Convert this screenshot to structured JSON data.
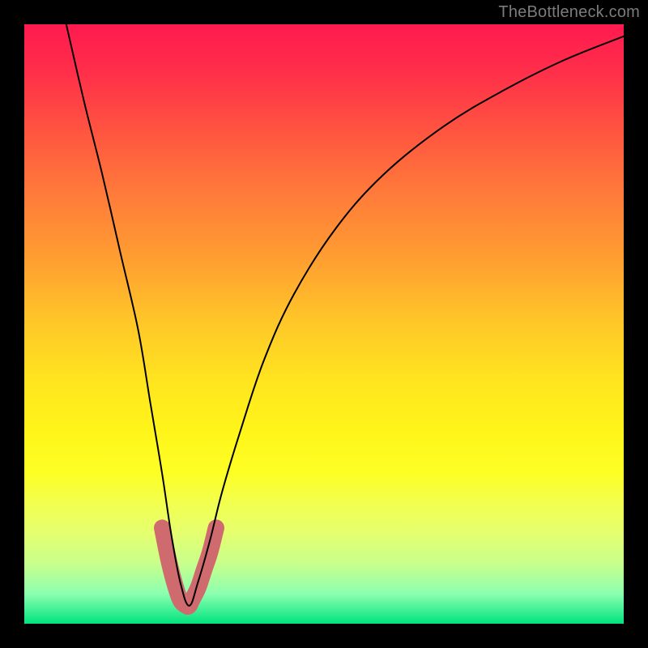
{
  "watermark": "TheBottleneck.com",
  "chart_data": {
    "type": "line",
    "title": "",
    "xlabel": "",
    "ylabel": "",
    "xlim": [
      0,
      100
    ],
    "ylim": [
      0,
      100
    ],
    "grid": false,
    "gradient_stops": [
      {
        "pos": 0,
        "color": "#ff1a4f"
      },
      {
        "pos": 50,
        "color": "#ffc828"
      },
      {
        "pos": 75,
        "color": "#fdff25"
      },
      {
        "pos": 100,
        "color": "#00e37e"
      }
    ],
    "series": [
      {
        "name": "bottleneck-curve",
        "color": "#000000",
        "stroke_width": 2,
        "x": [
          7,
          10,
          13,
          16,
          19,
          21,
          23,
          24.5,
          26,
          27.5,
          29,
          31,
          33,
          36,
          40,
          45,
          52,
          60,
          70,
          80,
          90,
          100
        ],
        "y": [
          100,
          87,
          75,
          62,
          49,
          37,
          25,
          15,
          7,
          3,
          7,
          14,
          22,
          32,
          44,
          55,
          66,
          75,
          83,
          89,
          94,
          98
        ]
      },
      {
        "name": "minimum-highlight",
        "color": "#cf6a6f",
        "stroke_width": 12,
        "linecap": "round",
        "x": [
          23,
          24,
          25,
          26,
          27,
          27.5,
          28,
          29,
          30,
          31,
          32
        ],
        "y": [
          16,
          11,
          7,
          4,
          3,
          3,
          4,
          6,
          9,
          12,
          16
        ]
      }
    ]
  }
}
